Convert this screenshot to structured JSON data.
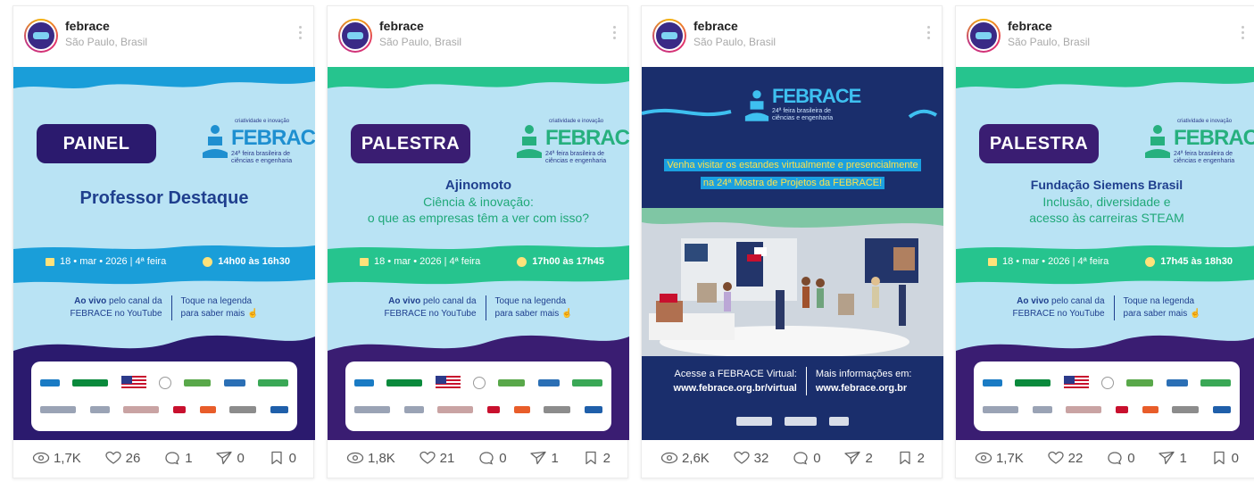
{
  "posts": [
    {
      "username": "febrace",
      "location": "São Paulo, Brasil",
      "poster": {
        "type": "PAINEL",
        "title_line1": "Professor Destaque",
        "title_line2": "",
        "title_line3": "",
        "date": "18 • mar • 2026 | 4ª feira",
        "time": "14h00 às 16h30",
        "live_left_bold": "Ao vivo",
        "live_left_rest": " pelo canal da",
        "live_left_line2": "FEBRACE no YouTube",
        "live_right1": "Toque na legenda",
        "live_right2": "para saber mais"
      },
      "stats": {
        "views": "1,7K",
        "likes": "26",
        "comments": "1",
        "shares": "0",
        "saves": "0"
      }
    },
    {
      "username": "febrace",
      "location": "São Paulo, Brasil",
      "poster": {
        "type": "PALESTRA",
        "title_line1": "Ajinomoto",
        "title_line2": "Ciência & inovação:",
        "title_line3": "o que as empresas têm a ver com isso?",
        "date": "18 • mar • 2026 | 4ª feira",
        "time": "17h00 às 17h45",
        "live_left_bold": "Ao vivo",
        "live_left_rest": " pelo canal da",
        "live_left_line2": "FEBRACE no YouTube",
        "live_right1": "Toque na legenda",
        "live_right2": "para saber mais"
      },
      "stats": {
        "views": "1,8K",
        "likes": "21",
        "comments": "0",
        "shares": "1",
        "saves": "2"
      }
    },
    {
      "username": "febrace",
      "location": "São Paulo, Brasil",
      "virtual": {
        "headline_line1": "Venha visitar os estandes virtualmente e presencialmente",
        "headline_line2": "na 24ª Mostra de Projetos da FEBRACE!",
        "left_line1": "Acesse a FEBRACE Virtual:",
        "left_line2": "www.febrace.org.br/virtual",
        "right_line1": "Mais informações em:",
        "right_line2": "www.febrace.org.br"
      },
      "stats": {
        "views": "2,6K",
        "likes": "32",
        "comments": "0",
        "shares": "2",
        "saves": "2"
      }
    },
    {
      "username": "febrace",
      "location": "São Paulo, Brasil",
      "poster": {
        "type": "PALESTRA",
        "title_line1": "Fundação Siemens Brasil",
        "title_line2": "Inclusão, diversidade e",
        "title_line3": "acesso às carreiras STEAM",
        "date": "18 • mar • 2026 | 4ª feira",
        "time": "17h45 às 18h30",
        "live_left_bold": "Ao vivo",
        "live_left_rest": " pelo canal da",
        "live_left_line2": "FEBRACE no YouTube",
        "live_right1": "Toque na legenda",
        "live_right2": "para saber mais"
      },
      "stats": {
        "views": "1,7K",
        "likes": "22",
        "comments": "0",
        "shares": "1",
        "saves": "0"
      }
    }
  ],
  "logo": {
    "name": "FEBRACE",
    "tagline": "24ª feira brasileira de ciências e engenharia"
  },
  "colors": {
    "painel_band": "#1a9ed9",
    "palestra_band": "#26c48e",
    "pill": "#2b1a6e",
    "virtual_bg": "#1a2e6c"
  }
}
